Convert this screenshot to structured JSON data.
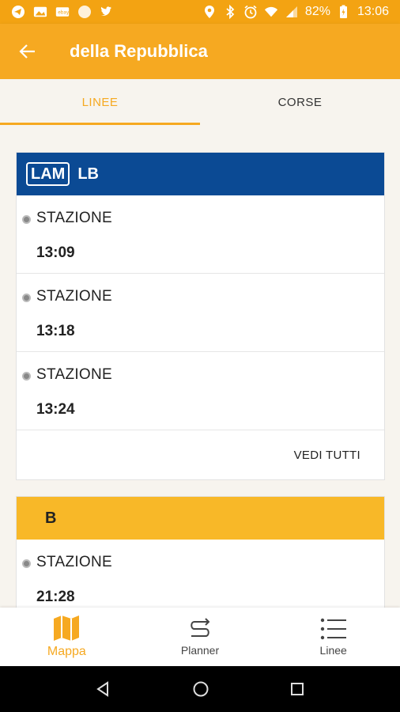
{
  "statusbar": {
    "battery": "82%",
    "time": "13:06"
  },
  "appbar": {
    "title": "della Repubblica"
  },
  "tabs": [
    {
      "label": "LINEE",
      "active": true
    },
    {
      "label": "CORSE",
      "active": false
    }
  ],
  "cards": [
    {
      "badge": "LAM",
      "code": "LB",
      "color": "#0b4a94",
      "rows": [
        {
          "stop": "STAZIONE",
          "time": "13:09"
        },
        {
          "stop": "STAZIONE",
          "time": "13:18"
        },
        {
          "stop": "STAZIONE",
          "time": "13:24"
        }
      ],
      "see_all": "VEDI TUTTI"
    },
    {
      "code": "B",
      "color": "#f8b828",
      "rows": [
        {
          "stop": "STAZIONE",
          "time": "21:28"
        }
      ]
    }
  ],
  "bottomnav": [
    {
      "label": "Mappa",
      "icon": "map-icon",
      "active": true
    },
    {
      "label": "Planner",
      "icon": "route-icon",
      "active": false
    },
    {
      "label": "Linee",
      "icon": "list-icon",
      "active": false
    }
  ],
  "colors": {
    "accent": "#f6a921",
    "lam_blue": "#0b4a94",
    "line_b_yellow": "#f8b828"
  }
}
